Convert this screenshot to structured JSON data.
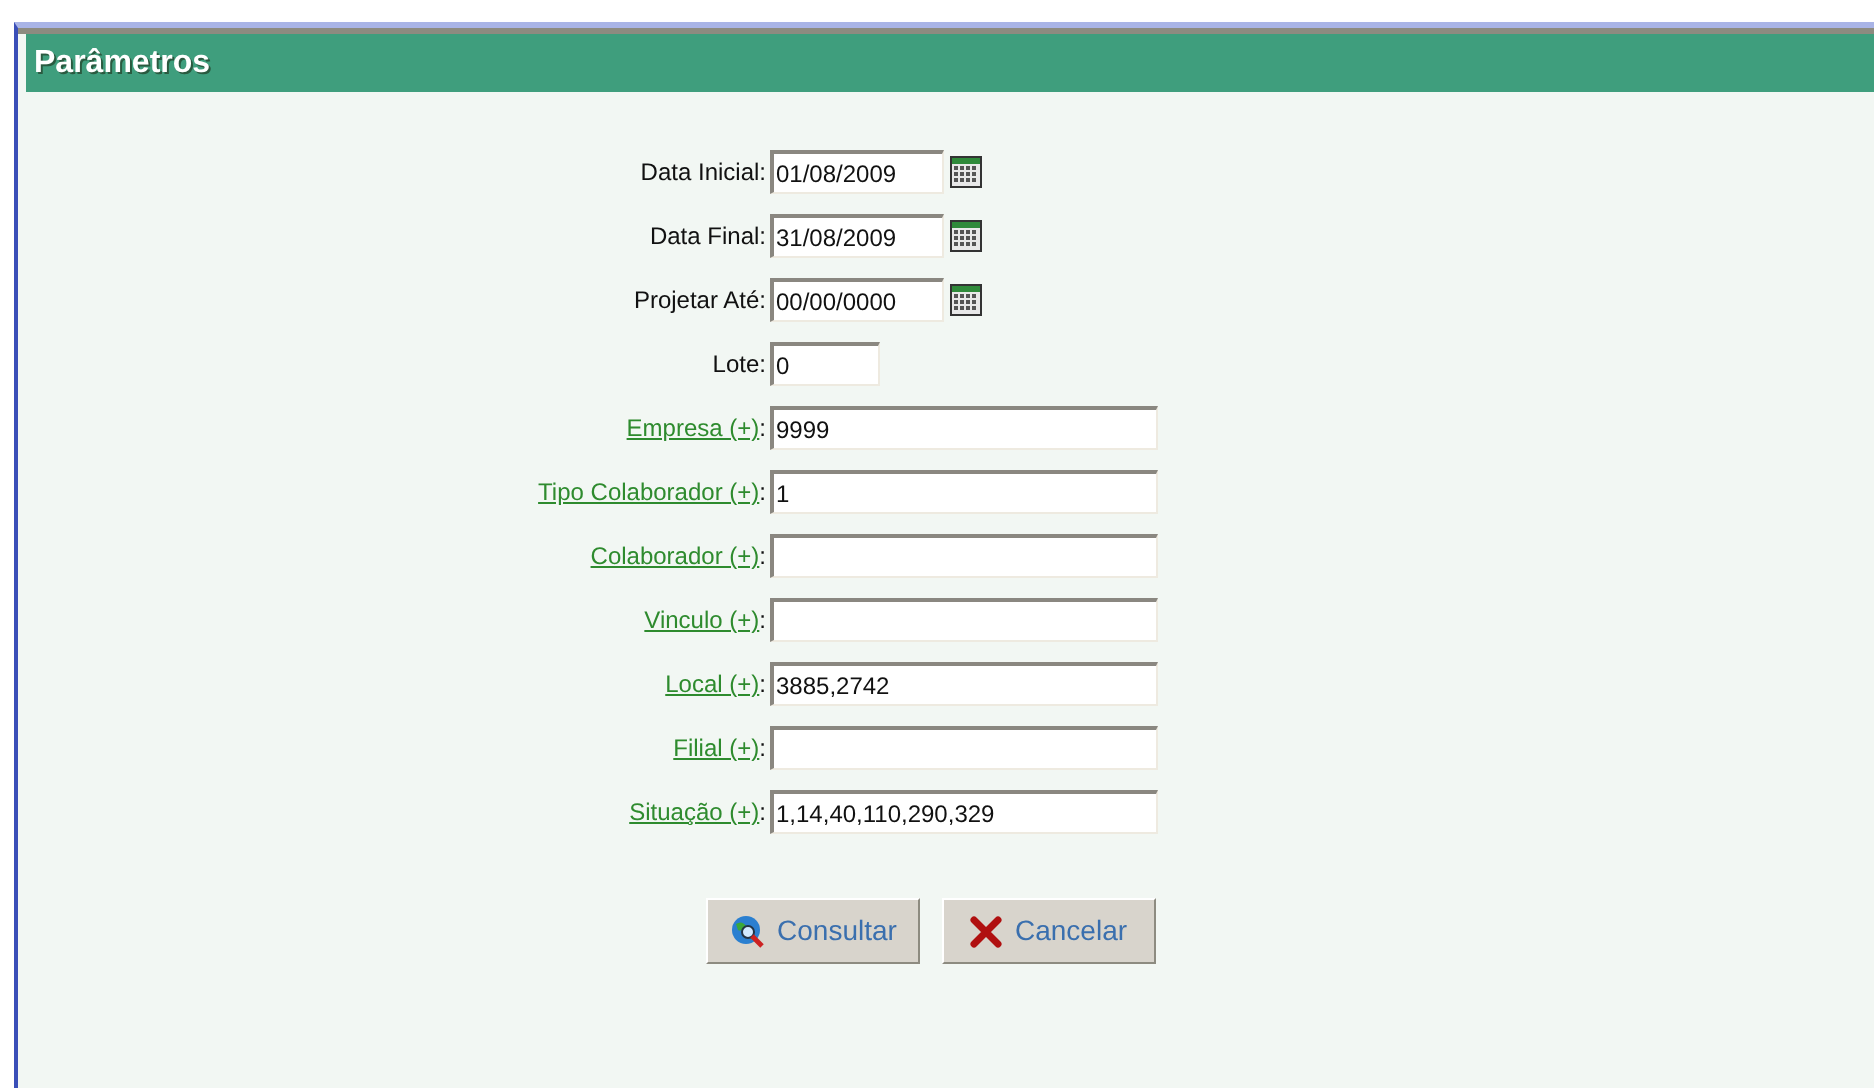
{
  "panel": {
    "title": "Parâmetros"
  },
  "fields": [
    {
      "label": "Data Inicial:",
      "value": "01/08/2009",
      "kind": "date",
      "link": false
    },
    {
      "label": "Data Final:",
      "value": "31/08/2009",
      "kind": "date",
      "link": false
    },
    {
      "label": "Projetar Até:",
      "value": "00/00/0000",
      "kind": "date",
      "link": false
    },
    {
      "label": "Lote:",
      "value": "0",
      "kind": "short",
      "link": false
    },
    {
      "label": "Empresa (+)",
      "suffix": ":",
      "value": "9999",
      "kind": "long",
      "link": true
    },
    {
      "label": "Tipo Colaborador (+)",
      "suffix": ":",
      "value": "1",
      "kind": "long",
      "link": true
    },
    {
      "label": "Colaborador (+)",
      "suffix": ":",
      "kind": "long",
      "link": true
    },
    {
      "label": "Vinculo (+)",
      "suffix": ":",
      "kind": "long",
      "link": true
    },
    {
      "label": "Local (+)",
      "suffix": ":",
      "value": "3885,2742",
      "kind": "long",
      "link": true
    },
    {
      "label": "Filial (+)",
      "suffix": ":",
      "kind": "long",
      "link": true
    },
    {
      "label": "Situação (+)",
      "suffix": ":",
      "value": "1,14,40,110,290,329",
      "kind": "long",
      "link": true
    }
  ],
  "buttons": [
    {
      "label": "Consultar",
      "kind": "search"
    },
    {
      "label": "Cancelar",
      "kind": "cancel"
    }
  ]
}
